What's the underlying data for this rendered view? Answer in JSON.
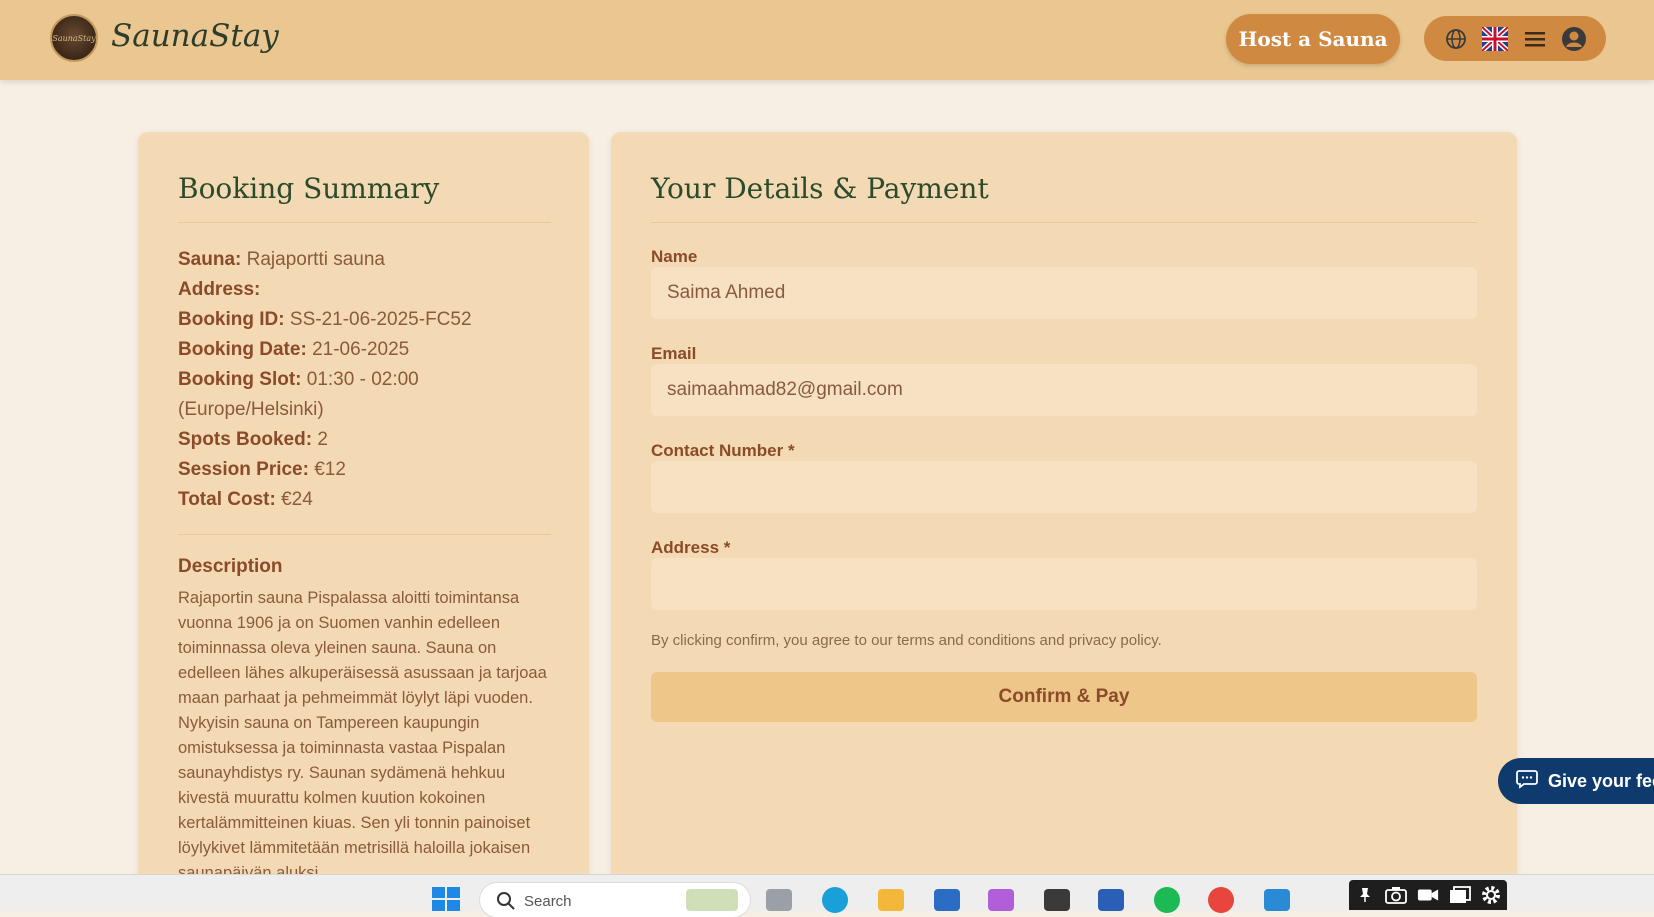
{
  "header": {
    "logo_text": "SaunaStay",
    "brand": "SaunaStay",
    "host_button": "Host a Sauna",
    "nav_icons": [
      "globe-icon",
      "uk-flag-icon",
      "menu-icon",
      "user-avatar-icon"
    ]
  },
  "summary": {
    "title": "Booking Summary",
    "rows": [
      {
        "label": "Sauna:",
        "value": "Rajaportti sauna"
      },
      {
        "label": "Address:",
        "value": ""
      },
      {
        "label": "Booking ID:",
        "value": "SS-21-06-2025-FC52"
      },
      {
        "label": "Booking Date:",
        "value": "21-06-2025"
      },
      {
        "label": "Booking Slot:",
        "value": "01:30 - 02:00 (Europe/Helsinki)"
      },
      {
        "label": "Spots Booked:",
        "value": "2"
      },
      {
        "label": "Session Price:",
        "value": "€12"
      },
      {
        "label": "Total Cost:",
        "value": "€24"
      }
    ],
    "description_title": "Description",
    "description": "Rajaportin sauna Pispalassa aloitti toimintansa vuonna 1906 ja on Suomen vanhin edelleen toiminnassa oleva yleinen sauna. Sauna on edelleen lähes alkuperäisessä asussaan ja tarjoaa maan parhaat ja pehmeimmät löylyt läpi vuoden. Nykyisin sauna on Tampereen kaupungin omistuksessa ja toiminnasta vastaa Pispalan saunayhdistys ry. Saunan sydämenä hehkuu kivestä muurattu kolmen kuution kokoinen kertalämmitteinen kiuas. Sen yli tonnin painoiset löylykivet lämmitetään metrisillä haloilla jokaisen saunapäivän aluksi."
  },
  "payment": {
    "title": "Your Details & Payment",
    "name_label": "Name",
    "name_value": "Saima Ahmed",
    "email_label": "Email",
    "email_value": "saimaahmad82@gmail.com",
    "contact_label": "Contact Number *",
    "contact_value": "",
    "address_label": "Address *",
    "address_value": "",
    "terms": "By clicking confirm, you agree to our terms and conditions and privacy policy.",
    "confirm_button": "Confirm & Pay"
  },
  "feedback": {
    "label": "Give your fee"
  },
  "taskbar": {
    "search_placeholder": "Search"
  },
  "colors": {
    "accent": "#d08941",
    "header_bg": "#eac690",
    "card_bg": "#f3dab4",
    "feedback_bg": "#0f3a6e"
  }
}
